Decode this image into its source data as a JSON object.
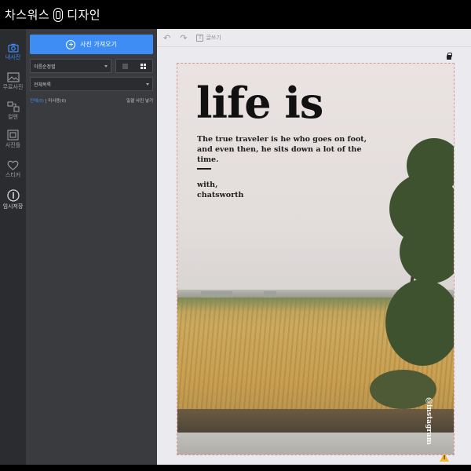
{
  "app": {
    "title_left": "차스워스",
    "title_right": "디자인"
  },
  "rail": {
    "items": [
      {
        "label": "내사진",
        "icon": "camera-icon",
        "active": true
      },
      {
        "label": "무료사진",
        "icon": "image-gallery-icon"
      },
      {
        "label": "컬렌",
        "icon": "collage-icon"
      },
      {
        "label": "사진틀",
        "icon": "frame-icon"
      },
      {
        "label": "스티커",
        "icon": "heart-icon"
      },
      {
        "label": "임시저장",
        "icon": "info-icon"
      }
    ]
  },
  "panel": {
    "import_button": "사진 가져오기",
    "sort_select": "이름순정렬",
    "folder_select": "전체목록",
    "filter_all": "전체(0)",
    "filter_separator": "|",
    "filter_unused": "미사용(0)",
    "bulk_insert": "일괄 사진 넣기"
  },
  "toolbar": {
    "text_label": "글쓰기"
  },
  "poster": {
    "title": "life is",
    "quote_line1": "The true traveler is he who goes on foot,",
    "quote_line2": "and even then, he sits down a lot of the time.",
    "sign_line1": "with,",
    "sign_line2": "chatsworth",
    "instagram": "@instagram"
  },
  "colors": {
    "accent": "#3d8df5",
    "panel": "#3a3b3f",
    "rail": "#2b2c30",
    "canvas": "#ebebef"
  }
}
